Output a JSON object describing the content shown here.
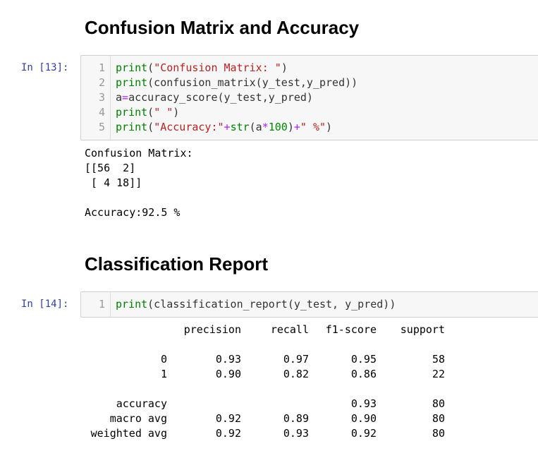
{
  "sections": {
    "confusion_heading": "Confusion Matrix and Accuracy",
    "report_heading": "Classification Report"
  },
  "cell13": {
    "prompt": "In [13]:",
    "lines": [
      {
        "n": "1",
        "parts": [
          {
            "t": "print",
            "c": "kw"
          },
          {
            "t": "(",
            "c": ""
          },
          {
            "t": "\"Confusion Matrix: \"",
            "c": "str"
          },
          {
            "t": ")",
            "c": ""
          }
        ]
      },
      {
        "n": "2",
        "parts": [
          {
            "t": "print",
            "c": "kw"
          },
          {
            "t": "(confusion_matrix(y_test,y_pred))",
            "c": ""
          }
        ]
      },
      {
        "n": "3",
        "parts": [
          {
            "t": "a",
            "c": ""
          },
          {
            "t": "=",
            "c": "op"
          },
          {
            "t": "accuracy_score(y_test,y_pred)",
            "c": ""
          }
        ]
      },
      {
        "n": "4",
        "parts": [
          {
            "t": "print",
            "c": "kw"
          },
          {
            "t": "(",
            "c": ""
          },
          {
            "t": "\" \"",
            "c": "str"
          },
          {
            "t": ")",
            "c": ""
          }
        ]
      },
      {
        "n": "5",
        "parts": [
          {
            "t": "print",
            "c": "kw"
          },
          {
            "t": "(",
            "c": ""
          },
          {
            "t": "\"Accuracy:\"",
            "c": "str"
          },
          {
            "t": "+",
            "c": "op"
          },
          {
            "t": "str",
            "c": "kw"
          },
          {
            "t": "(a",
            "c": ""
          },
          {
            "t": "*",
            "c": "op"
          },
          {
            "t": "100",
            "c": "num"
          },
          {
            "t": ")",
            "c": ""
          },
          {
            "t": "+",
            "c": "op"
          },
          {
            "t": "\" %\"",
            "c": "str"
          },
          {
            "t": ")",
            "c": ""
          }
        ]
      }
    ],
    "output": "Confusion Matrix: \n[[56  2]\n [ 4 18]]\n\nAccuracy:92.5 %"
  },
  "cell14": {
    "prompt": "In [14]:",
    "lines": [
      {
        "n": "1",
        "parts": [
          {
            "t": "print",
            "c": "kw"
          },
          {
            "t": "(classification_report(y_test, y_pred))",
            "c": ""
          }
        ]
      }
    ]
  },
  "report": {
    "columns": [
      "precision",
      "recall",
      "f1-score",
      "support"
    ],
    "rows": [
      {
        "label": "0",
        "values": [
          "0.93",
          "0.97",
          "0.95",
          "58"
        ]
      },
      {
        "label": "1",
        "values": [
          "0.90",
          "0.82",
          "0.86",
          "22"
        ]
      },
      {
        "label": "accuracy",
        "values": [
          "",
          "",
          "0.93",
          "80"
        ]
      },
      {
        "label": "macro avg",
        "values": [
          "0.92",
          "0.89",
          "0.90",
          "80"
        ]
      },
      {
        "label": "weighted avg",
        "values": [
          "0.92",
          "0.93",
          "0.92",
          "80"
        ]
      }
    ]
  }
}
